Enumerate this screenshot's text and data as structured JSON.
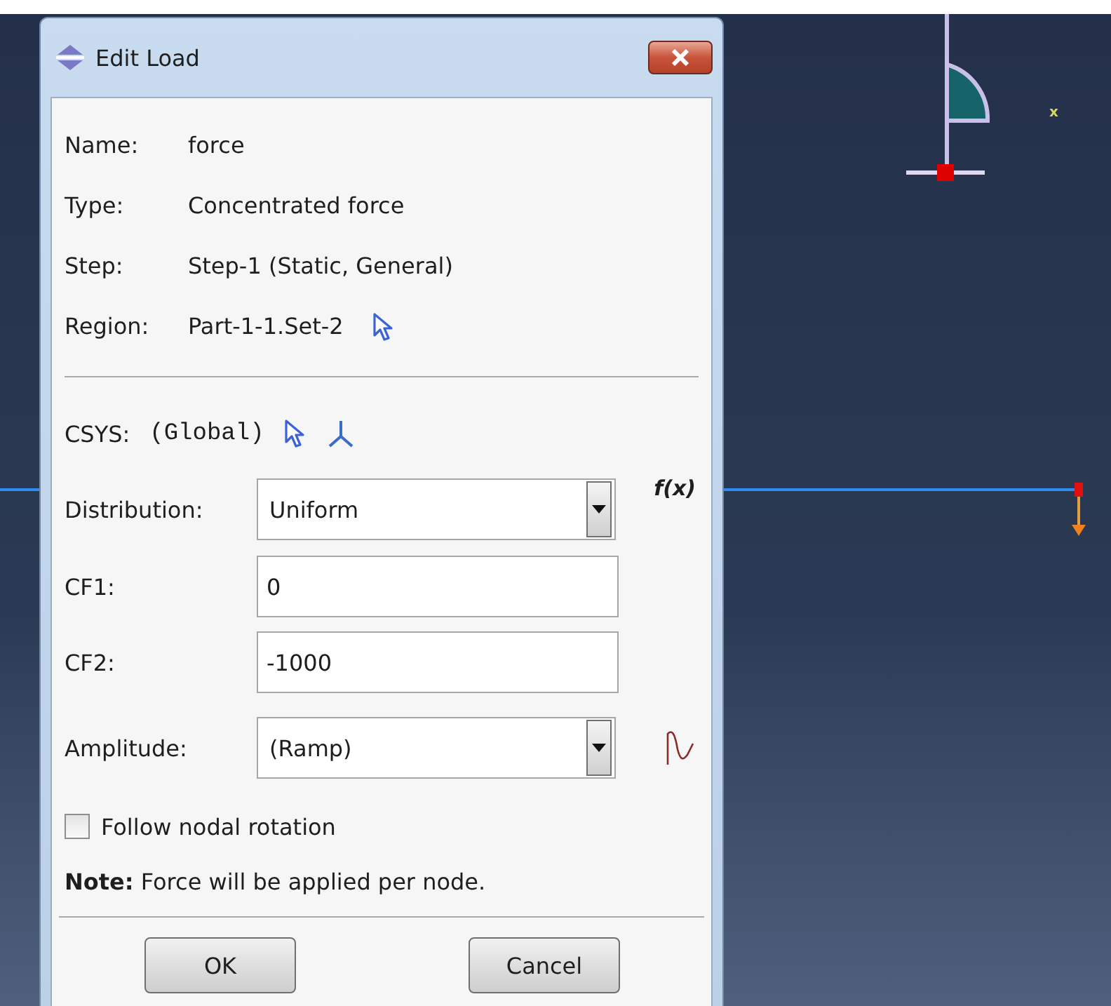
{
  "window": {
    "title": "Edit Load"
  },
  "info": [
    {
      "label": "Name:",
      "value": "force",
      "kind": "plain"
    },
    {
      "label": "Type:",
      "value": "Concentrated force",
      "kind": "plain"
    },
    {
      "label": "Step:",
      "value": "Step-1 (Static, General)",
      "kind": "plain"
    },
    {
      "label": "Region:",
      "value": "Part-1-1.Set-2",
      "kind": "pick"
    }
  ],
  "csys": {
    "label": "CSYS:",
    "value": "(Global)"
  },
  "distribution": {
    "label": "Distribution:",
    "value": "Uniform",
    "function_label": "f(x)"
  },
  "fields": [
    {
      "label": "CF1:",
      "value": "0"
    },
    {
      "label": "CF2:",
      "value": "-1000"
    }
  ],
  "amplitude": {
    "label": "Amplitude:",
    "value": "(Ramp)"
  },
  "follow_nodal_rotation": {
    "label": "Follow nodal rotation",
    "checked": false
  },
  "note": "**Note:** Force will be applied per node.",
  "buttons": [
    "OK",
    "Cancel"
  ],
  "viewport": {
    "axis_label": "x"
  }
}
